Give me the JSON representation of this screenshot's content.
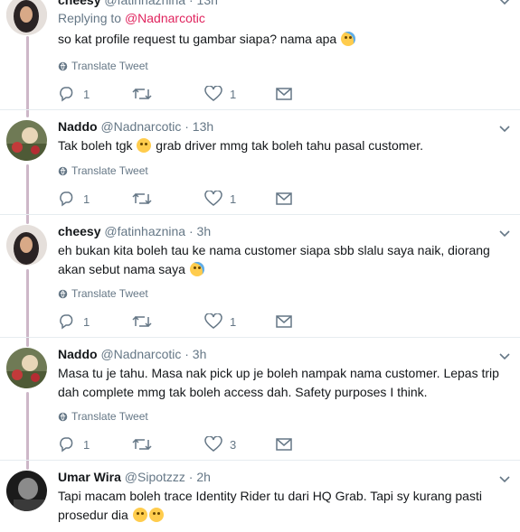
{
  "tweets": [
    {
      "name": "cheesy",
      "handle": "@fatinhaznina · 13h",
      "replying_prefix": "Replying to",
      "replying_to": "@Nadnarcotic",
      "text": "so kat profile request tu gambar siapa? nama apa",
      "emoji": [
        "face-with-tears-of-joy"
      ],
      "translate": "Translate Tweet",
      "replies": "1",
      "retweets": "",
      "likes": "1"
    },
    {
      "name": "Naddo",
      "handle": "@Nadnarcotic · 13h",
      "text_a": "Tak boleh tgk",
      "text_b": "grab driver mmg tak boleh tahu pasal customer.",
      "emoji": [
        "slightly-frowning-face"
      ],
      "translate": "Translate Tweet",
      "replies": "1",
      "retweets": "",
      "likes": "1"
    },
    {
      "name": "cheesy",
      "handle": "@fatinhaznina · 3h",
      "text_line1": "eh bukan kita boleh tau ke nama customer siapa sbb slalu saya naik, diorang",
      "text_line2": "akan sebut nama saya",
      "emoji": [
        "face-with-tears-of-joy"
      ],
      "translate": "Translate Tweet",
      "replies": "1",
      "retweets": "",
      "likes": "1"
    },
    {
      "name": "Naddo",
      "handle": "@Nadnarcotic · 3h",
      "text_line1": "Masa tu je tahu. Masa nak pick up je boleh nampak nama customer. Lepas trip",
      "text_line2": "dah complete mmg tak boleh access dah. Safety purposes I think.",
      "translate": "Translate Tweet",
      "replies": "1",
      "retweets": "",
      "likes": "3"
    },
    {
      "name": "Umar Wira",
      "handle": "@Sipotzzz · 2h",
      "text_line1": "Tapi macam boleh trace Identity Rider tu dari HQ Grab. Tapi sy kurang pasti",
      "text_line2": "prosedur dia",
      "emoji": [
        "crying-face",
        "confounded-face"
      ]
    }
  ],
  "colors": {
    "mention": "#e0245e",
    "muted": "#657786",
    "thread_line": "#cdb7c8"
  }
}
